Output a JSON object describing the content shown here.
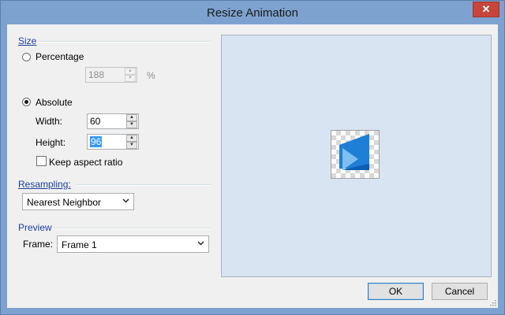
{
  "window": {
    "title": "Resize Animation",
    "close_symbol": "✕"
  },
  "size": {
    "group_label": "Size",
    "percentage_label": "Percentage",
    "percentage_value": "188",
    "percent_unit": "%",
    "absolute_label": "Absolute",
    "width_label": "Width:",
    "width_value": "60",
    "height_label": "Height:",
    "height_value": "96",
    "keep_aspect_label": "Keep aspect ratio",
    "mode": "absolute",
    "keep_aspect": false
  },
  "resampling": {
    "group_label": "Resampling:",
    "selected": "Nearest Neighbor"
  },
  "preview": {
    "group_label": "Preview",
    "frame_label": "Frame:",
    "frame_selected": "Frame 1"
  },
  "buttons": {
    "ok": "OK",
    "cancel": "Cancel"
  },
  "colors": {
    "accent": "#1f3f9b",
    "preview_bg": "#d8e4f2",
    "selection": "#3399ff",
    "icon_blue": "#1e7fd6"
  }
}
